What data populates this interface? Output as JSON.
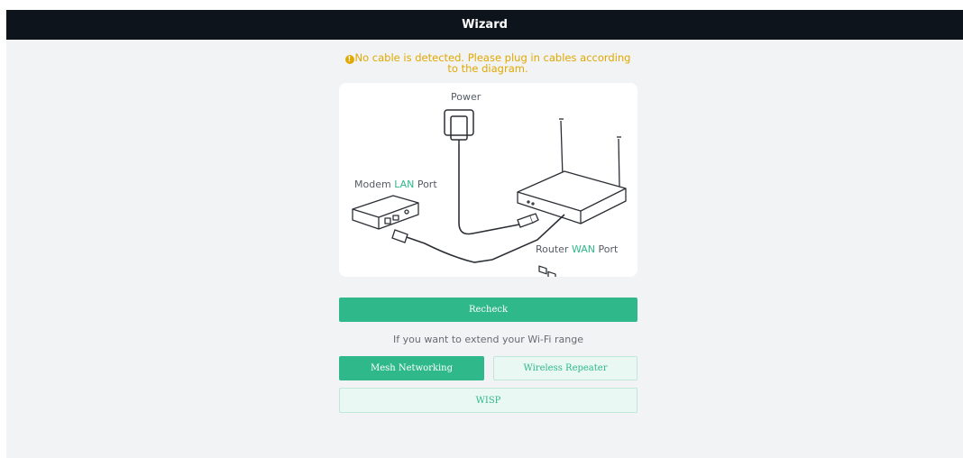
{
  "header": {
    "title": "Wizard"
  },
  "warning": {
    "icon": "warning-circle-icon",
    "text": "No cable is detected. Please plug in cables according to the diagram."
  },
  "diagram": {
    "power_label": "Power",
    "modem_label_prefix": "Modem ",
    "modem_label_accent": "LAN",
    "modem_label_suffix": " Port",
    "router_label_prefix": "Router ",
    "router_label_accent": "WAN",
    "router_label_suffix": " Port"
  },
  "actions": {
    "recheck": "Recheck",
    "extend_hint": "If you want to extend your Wi-Fi range",
    "mesh": "Mesh Networking",
    "repeater": "Wireless Repeater",
    "wisp": "WISP"
  },
  "colors": {
    "accent": "#2fb88a",
    "warning": "#e0a800",
    "header_bg": "#0e141c"
  }
}
